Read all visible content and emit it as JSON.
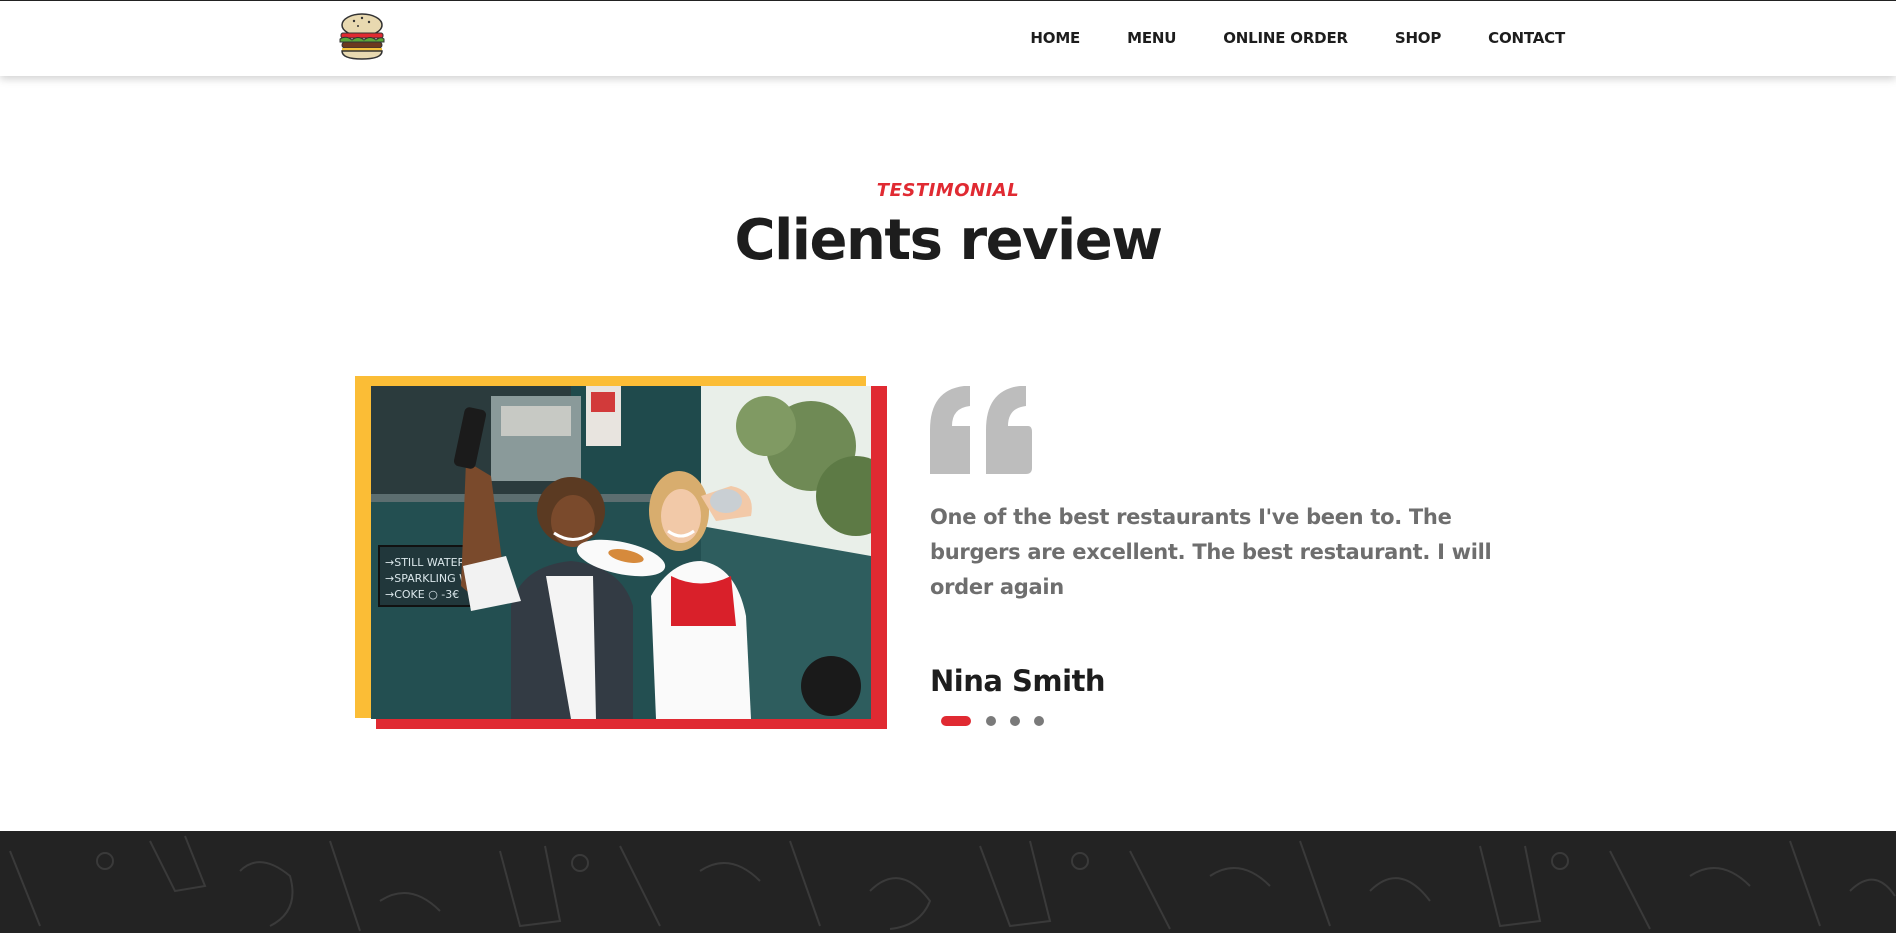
{
  "nav": {
    "items": [
      {
        "label": "HOME"
      },
      {
        "label": "MENU"
      },
      {
        "label": "ONLINE ORDER"
      },
      {
        "label": "SHOP"
      },
      {
        "label": "CONTACT"
      }
    ]
  },
  "testimonial": {
    "eyebrow": "TESTIMONIAL",
    "title": "Clients review",
    "quote": "One of the best restaurants I've been to. The burgers are excellent. The best restaurant. I will order again",
    "reviewer": "Nina Smith",
    "photo_chalkboard": [
      "→STILL WATER",
      "→SPARKLING WA",
      "→COKE ○ -3€"
    ],
    "slider": {
      "total": 4,
      "active": 1
    }
  },
  "colors": {
    "accent_red": "#e02a32",
    "accent_yellow": "#fbbd36",
    "footer_bg": "#232323",
    "quote_gray": "#bdbdbd"
  },
  "icons": {
    "logo": "burger-logo-icon",
    "quote": "quote-mark-icon"
  }
}
